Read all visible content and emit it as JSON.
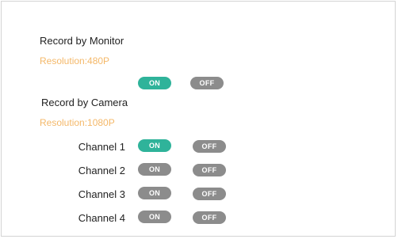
{
  "colors": {
    "active": "#2fb39a",
    "inactive": "#8c8c8c",
    "resolution": "#f4b869"
  },
  "monitor": {
    "title": "Record by Monitor",
    "resolution": "Resolution:480P",
    "on_label": "ON",
    "off_label": "OFF",
    "state": "on"
  },
  "camera": {
    "title": "Record by Camera",
    "resolution": "Resolution:1080P",
    "channels": [
      {
        "label": "Channel 1",
        "on_label": "ON",
        "off_label": "OFF",
        "state": "on"
      },
      {
        "label": "Channel 2",
        "on_label": "ON",
        "off_label": "OFF",
        "state": "off"
      },
      {
        "label": "Channel 3",
        "on_label": "ON",
        "off_label": "OFF",
        "state": "off"
      },
      {
        "label": "Channel 4",
        "on_label": "ON",
        "off_label": "OFF",
        "state": "off"
      }
    ]
  }
}
